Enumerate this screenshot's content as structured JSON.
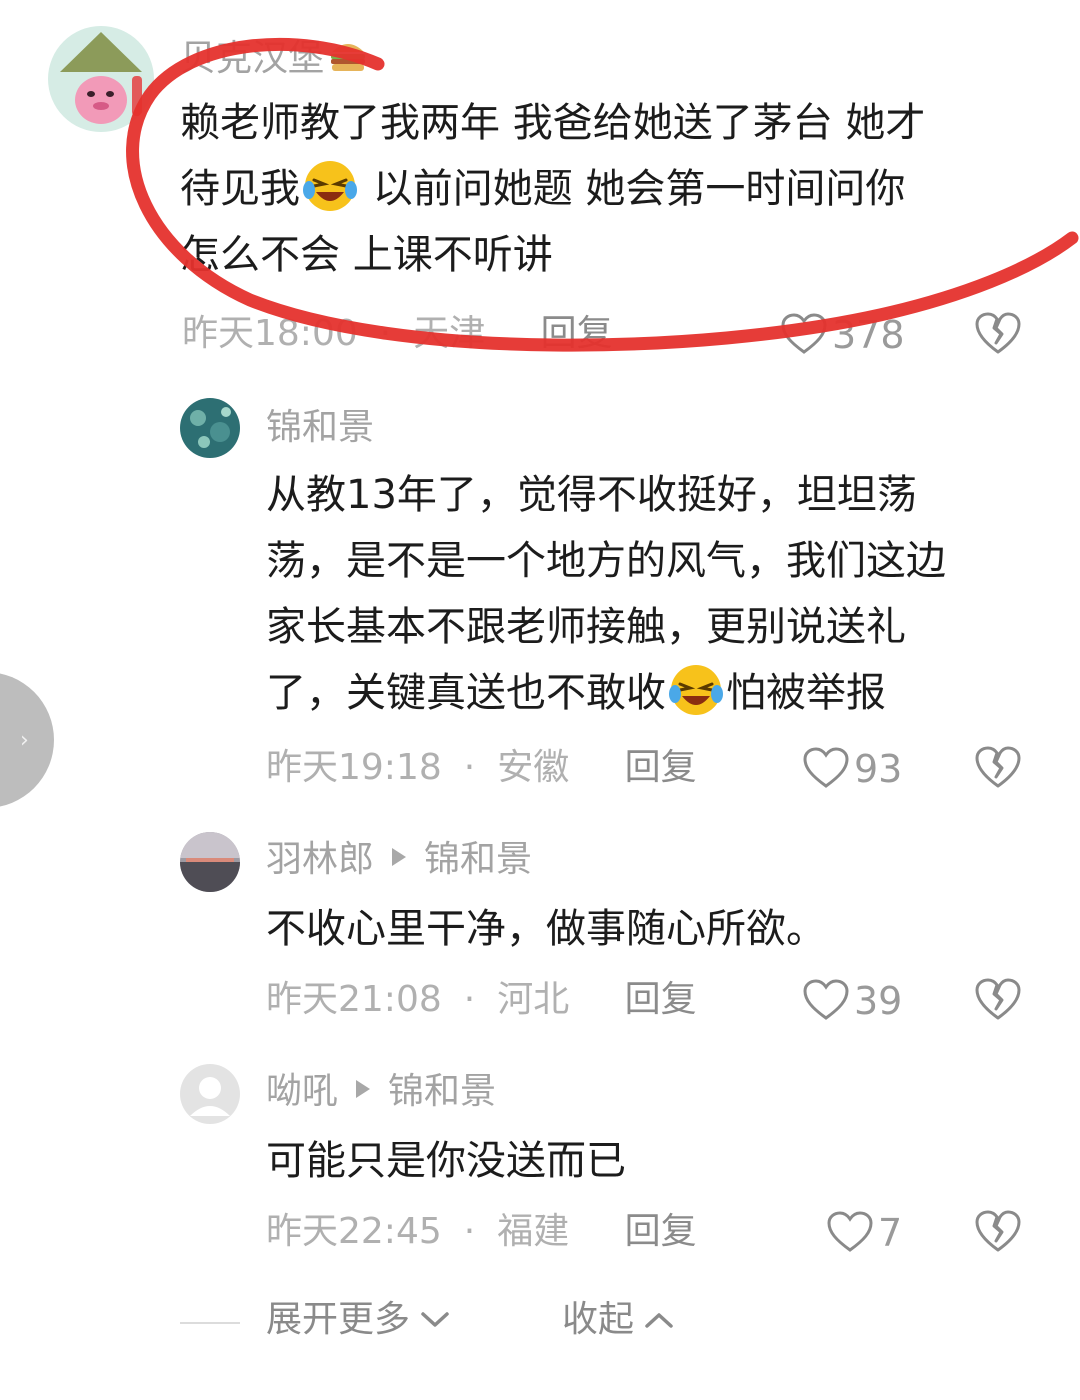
{
  "colors": {
    "text": "#1c1c1c",
    "secondary": "#a3a3a3",
    "annotation_red": "#e5322d",
    "handle": "#bdbdbd"
  },
  "comments": [
    {
      "author": "贝克汉堡",
      "author_icon": "hamburger-emoji",
      "reply_to": "",
      "lines": [
        "赖老师教了我两年 我爸给她送了茅台 她才",
        [
          "待见我",
          "laugh-cry-emoji",
          " 以前问她题 她会第一时间问你"
        ],
        "怎么不会 上课不听讲"
      ],
      "time": "昨天18:00",
      "location": "天津",
      "reply_label": "回复",
      "likes": "378"
    },
    {
      "author": "锦和景",
      "reply_to": "",
      "lines": [
        "从教13年了，觉得不收挺好，坦坦荡",
        "荡，是不是一个地方的风气，我们这边",
        "家长基本不跟老师接触，更别说送礼",
        [
          "了，关键真送也不敢收",
          "laugh-cry-emoji",
          "怕被举报"
        ]
      ],
      "time": "昨天19:18",
      "location": "安徽",
      "reply_label": "回复",
      "likes": "93"
    },
    {
      "author": "羽林郎",
      "reply_to": "锦和景",
      "lines": [
        "不收心里干净，做事随心所欲。"
      ],
      "time": "昨天21:08",
      "location": "河北",
      "reply_label": "回复",
      "likes": "39"
    },
    {
      "author": "呦吼",
      "reply_to": "锦和景",
      "lines": [
        "可能只是你没送而已"
      ],
      "time": "昨天22:45",
      "location": "福建",
      "reply_label": "回复",
      "likes": "7"
    }
  ],
  "footer": {
    "expand_label": "展开更多",
    "collapse_label": "收起"
  },
  "side_handle_icon": "chevron-right-icon"
}
